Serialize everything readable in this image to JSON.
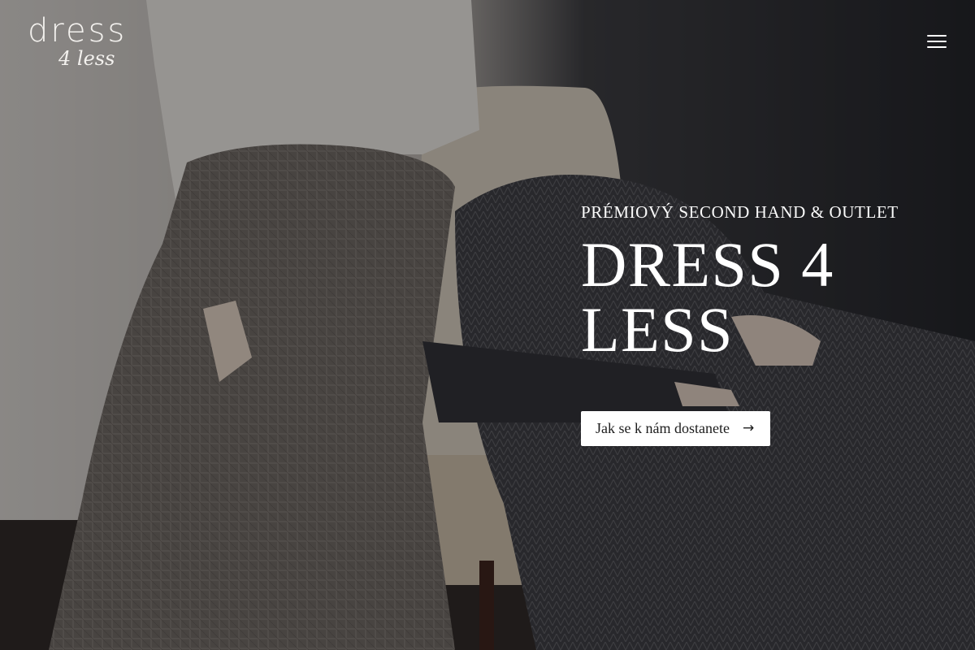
{
  "site": {
    "logo": {
      "top": "dress",
      "bottom": "4 less"
    },
    "menu_icon": "hamburger-menu-icon"
  },
  "hero": {
    "kicker": "PRÉMIOVÝ SECOND HAND & OUTLET",
    "title": "DRESS 4 LESS",
    "cta_label": "Jak se k nám dostanete",
    "cta_icon": "arrow-right-icon",
    "cta_arrow": "→"
  },
  "colors": {
    "overlay": "#000000",
    "text": "#ffffff",
    "button_bg": "#ffffff",
    "button_text": "#1d1d1d"
  }
}
